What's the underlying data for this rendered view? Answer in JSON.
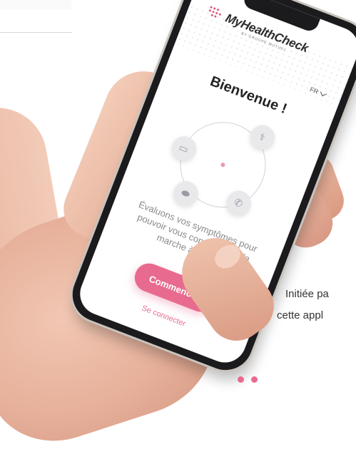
{
  "app": {
    "logo_text": "MyHealthCheck",
    "logo_subtitle": "BY GROUPE MUTUEL",
    "language": "FR"
  },
  "welcome": {
    "title": "Bienvenue !",
    "description": "Évaluons vos symptômes pour pouvoir vous conseiller sur la marche à suivre."
  },
  "actions": {
    "start_button": "Commencer",
    "login_link": "Se connecter"
  },
  "side_text": {
    "line1": "Initiée pa",
    "line2": "cette appl"
  },
  "icons": [
    "folder-icon",
    "stethoscope-icon",
    "pill-icon",
    "phone-icon"
  ],
  "colors": {
    "accent": "#e86b8f",
    "brand": "#e0547c"
  }
}
